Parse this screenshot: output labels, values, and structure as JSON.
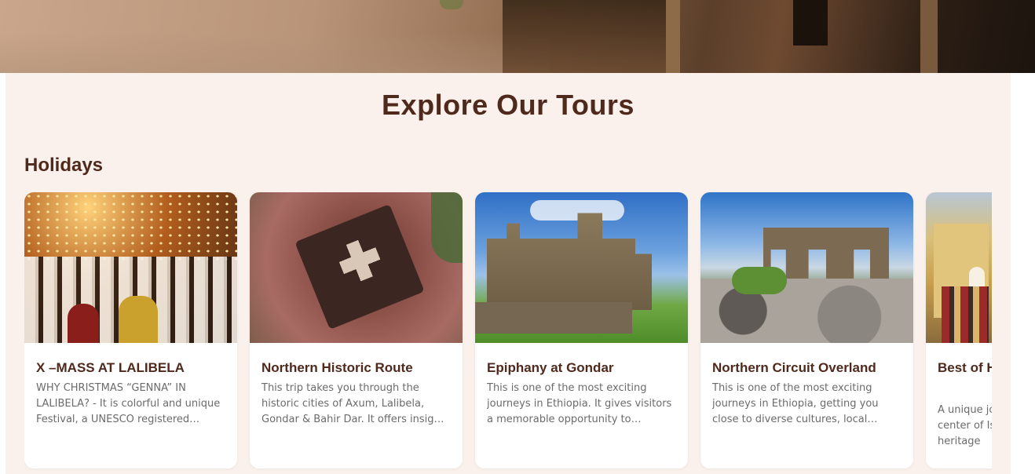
{
  "hero": {
    "image": "rock-hewn church exterior"
  },
  "section": {
    "title": "Explore Our Tours",
    "subtitle": "Holidays"
  },
  "cards": [
    {
      "title": "X –MASS AT LALIBELA",
      "description": "WHY CHRISTMAS “GENNA” IN LALIBELA? - It is colorful and unique Festival, a UNESCO registered heritage celebrated by pilgrims",
      "image": "christmas-candles-crowd"
    },
    {
      "title": "Northern Historic Route",
      "description": "This trip takes you through the historic cities of Axum, Lalibela, Gondar & Bahir Dar. It offers insight into the history",
      "image": "rock-hewn-church-aerial"
    },
    {
      "title": "Epiphany at Gondar",
      "description": "This is one of the most exciting journeys in Ethiopia. It gives visitors a memorable opportunity to celebrate Timket",
      "image": "gondar-castle"
    },
    {
      "title": "Northern Circuit Overland",
      "description": "This is one of the most exciting journeys in Ethiopia, getting you close to diverse cultures, local people, and landscapes",
      "image": "stone-bridge-landscape"
    },
    {
      "title": "Best of Harar and Alideghe",
      "description": "A unique journey visiting Harar, a center of Islamic culture and heritage",
      "image": "harar-gate-street"
    }
  ],
  "colors": {
    "section_bg": "#faf1ec",
    "heading": "#4f2a1c",
    "body_text": "#6b6b6b",
    "card_bg": "#ffffff"
  }
}
